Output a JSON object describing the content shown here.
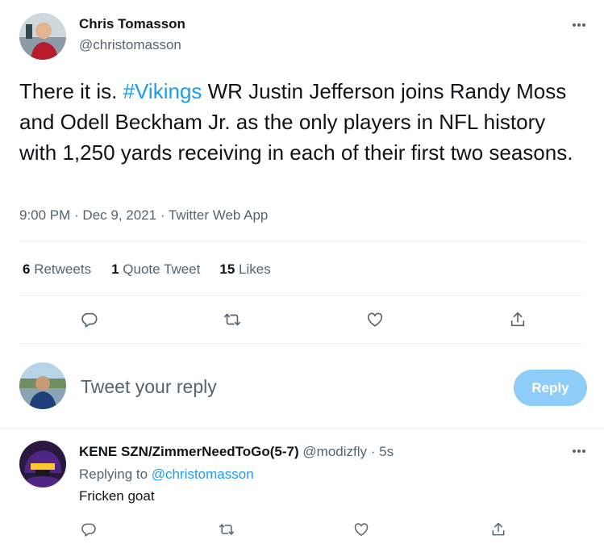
{
  "tweet": {
    "author_name": "Chris Tomasson",
    "author_handle": "@christomasson",
    "text_prefix": "There it is. ",
    "hashtag": "#Vikings",
    "text_body": " WR Justin Jefferson joins Randy Moss and Odell Beckham Jr. as the only players in NFL history with 1,250 yards receiving in each of their first two seasons.",
    "time": "9:00 PM",
    "date": "Dec 9, 2021",
    "source": "Twitter Web App",
    "separator": " · ",
    "stats": {
      "retweets_count": "6",
      "retweets_label": "Retweets",
      "quotes_count": "1",
      "quotes_label": "Quote Tweet",
      "likes_count": "15",
      "likes_label": "Likes"
    }
  },
  "composer": {
    "placeholder": "Tweet your reply",
    "reply_button": "Reply"
  },
  "reply": {
    "author_name": "KENE SZN/ZimmerNeedToGo(5-7)",
    "author_handle": "@modizfly",
    "separator": " · ",
    "age": "5s",
    "replying_to_label": "Replying to",
    "replying_to_handle": "@christomasson",
    "text": "Fricken goat"
  },
  "colors": {
    "accent": "#1d9bf0",
    "reply_button_disabled": "#8ecdf7",
    "muted_text": "#536471",
    "divider": "#eff3f4"
  },
  "icons": [
    "more-icon",
    "reply-icon",
    "retweet-icon",
    "like-icon",
    "share-icon"
  ]
}
